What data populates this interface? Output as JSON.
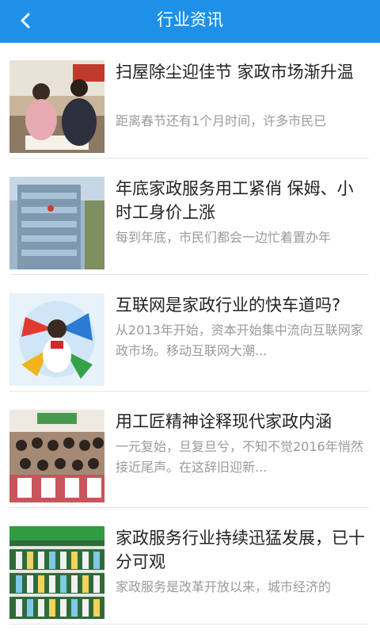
{
  "header": {
    "title": "行业资讯",
    "back_icon": "chevron-left-icon"
  },
  "colors": {
    "header_bg": "#1e90e8",
    "title_text": "#222222",
    "summary_text": "#9a9a9a"
  },
  "articles": [
    {
      "title": "扫屋除尘迎佳节 家政市场渐升温",
      "summary": "距离春节还有1个月时间，许多市民已"
    },
    {
      "title": "年底家政服务用工紧俏 保姆、小时工身价上涨",
      "summary": "每到年底，市民们都会一边忙着置办年"
    },
    {
      "title": "互联网是家政行业的快车道吗?",
      "summary": "从2013年开始，资本开始集中流向互联网家政市场。移动互联网大潮..."
    },
    {
      "title": "用工匠精神诠释现代家政内涵",
      "summary": "一元复始，旦复旦兮，不知不觉2016年悄然接近尾声。在这辞旧迎新..."
    },
    {
      "title": "家政服务行业持续迅猛发展，已十分可观",
      "summary": "家政服务是改革开放以来，城市经济的"
    }
  ]
}
